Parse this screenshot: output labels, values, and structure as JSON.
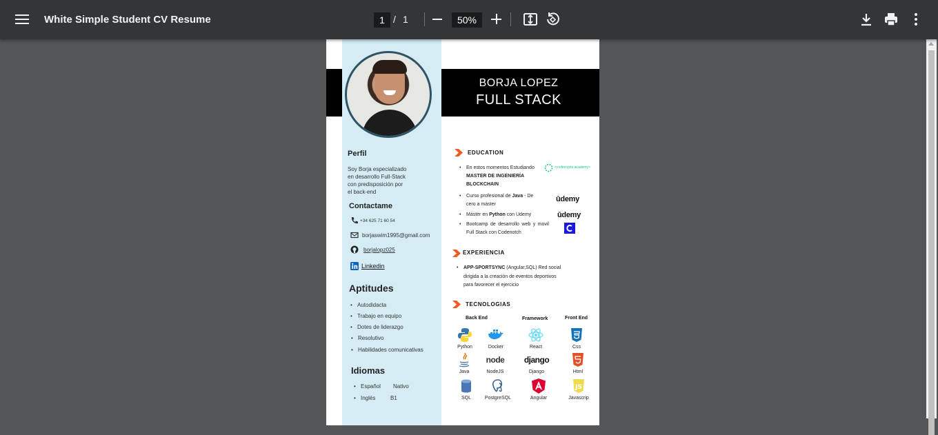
{
  "toolbar": {
    "title": "White Simple Student CV Resume",
    "page_current": "1",
    "page_sep": "/",
    "page_total": "1",
    "zoom": "50%",
    "icons": [
      "menu-icon",
      "zoom-out-icon",
      "zoom-in-icon",
      "fit-page-icon",
      "rotate-icon",
      "download-icon",
      "print-icon",
      "more-icon"
    ]
  },
  "resume": {
    "name": "BORJA LOPEZ",
    "role": "FULL STACK",
    "perfil_title": "Perfil",
    "perfil_lines": [
      "Soy Borja especializado",
      "en desarrollo Full-Stack",
      "con predisposición por",
      "el back-end"
    ],
    "contact_title": "Contactame",
    "phone": "+34 625 71 60 54",
    "email": "borjaswim1995@gmail.com",
    "github": "borjalopz025",
    "linkedin": "Linkedin",
    "skills_title": "Aptitudes",
    "skills": [
      "Autodidacta",
      "Trabajo en equipo",
      "Dotes de liderazgo",
      "Resolutivo",
      "Habilidades comunicativas"
    ],
    "lang_title": "Idiomas",
    "languages": [
      {
        "name": "Español",
        "level": "Nativo"
      },
      {
        "name": "Inglés",
        "level": "B1"
      }
    ],
    "education_title": "EDUCATION",
    "edu": [
      {
        "pre": "En estos momentos Estudiando",
        "bold": "MASTER DE INGENIERÍA BLOCKCHAIN",
        "post": ""
      },
      {
        "pre": "Curso profesional de ",
        "bold": "Java",
        "post": " - De cero a máster"
      },
      {
        "pre": "Máster en ",
        "bold": "Python",
        "post": " con Udemy"
      },
      {
        "pre": "Bootcamp de desarrollo web y movil Full Stack con Codenotch",
        "bold": "",
        "post": ""
      }
    ],
    "codecrypto": "<codecrypto.academy>",
    "udemy": "ūdemy",
    "experience_title": "EXPERIENCIA",
    "exp_bold": "APP-SPORTSYNC",
    "exp_text": " (Angular,SQL) Red social dirigida a la creación de eventos deportivos para favorecer el ejercicio",
    "tech_title": "TECNOLOGIAS",
    "tech_heads": {
      "back": "Back End",
      "framework": "Framework",
      "front": "Front End"
    },
    "tech": [
      {
        "label": "Python",
        "icon": "python-icon"
      },
      {
        "label": "Docker",
        "icon": "docker-icon"
      },
      {
        "label": "React",
        "icon": "react-icon"
      },
      {
        "label": "Css",
        "icon": "css-icon"
      },
      {
        "label": "Java",
        "icon": "java-icon"
      },
      {
        "label": "NodeJS",
        "icon": "node-icon"
      },
      {
        "label": "Django",
        "icon": "django-icon"
      },
      {
        "label": "Html",
        "icon": "html-icon"
      },
      {
        "label": "SQL",
        "icon": "sql-icon"
      },
      {
        "label": "PostgreSQL",
        "icon": "postgresql-icon"
      },
      {
        "label": "Angular",
        "icon": "angular-icon"
      },
      {
        "label": "Javascrip",
        "icon": "javascript-icon"
      }
    ],
    "node_logo": "node",
    "django_logo": "django",
    "colors": {
      "accent": "#f15a24",
      "sidebar": "#d5ecf4"
    }
  }
}
